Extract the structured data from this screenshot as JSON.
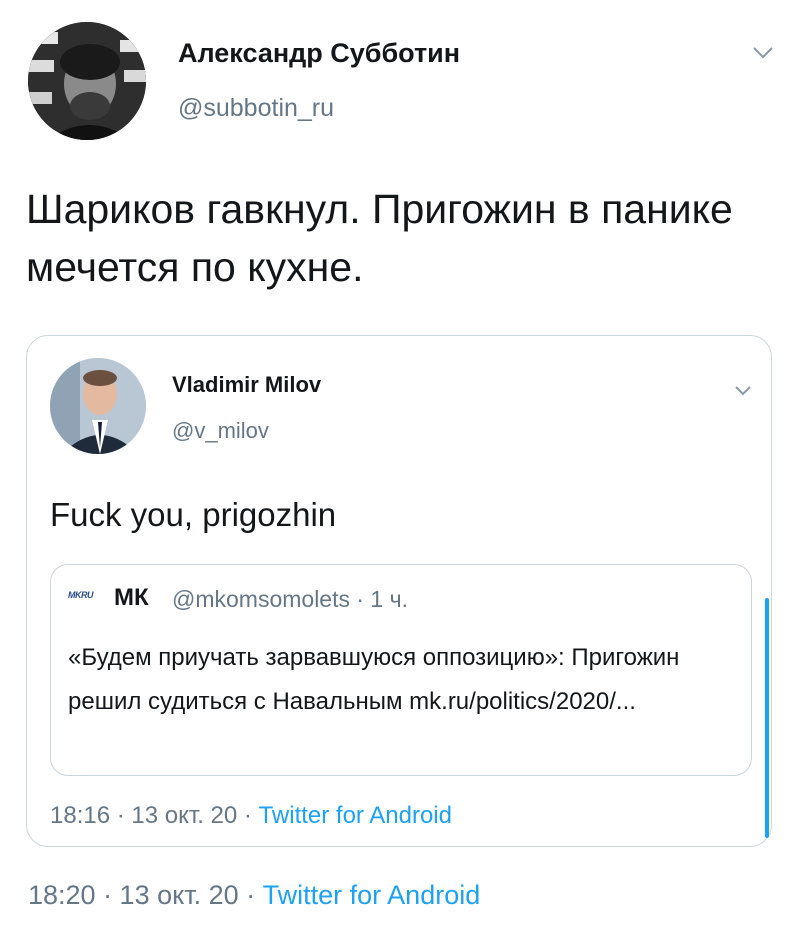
{
  "tweet": {
    "author_name": "Александр Субботин",
    "author_handle": "@subbotin_ru",
    "text": "Шариков гавкнул. Пригожин в панике мечется по кухне.",
    "time": "18:20 · 13 окт. 20 · ",
    "source": "Twitter for Android",
    "menu_icon": "chevron-down-icon"
  },
  "quoted": {
    "author_name": "Vladimir Milov",
    "author_handle": "@v_milov",
    "text": "Fuck you, prigozhin",
    "time": "18:16 · 13 окт. 20 · ",
    "source": "Twitter for Android",
    "menu_icon": "chevron-down-icon",
    "nested": {
      "logo_text": "MKRU",
      "author_name": "МК",
      "meta": "@mkomsomolets · 1 ч.",
      "text": "«Будем приучать зарвавшуюся оппозицию»: Пригожин решил судиться с Навальным mk.ru/politics/2020/..."
    }
  },
  "colors": {
    "accent": "#1da1f2",
    "secondary_text": "#657786",
    "border": "#ccd6dd"
  }
}
